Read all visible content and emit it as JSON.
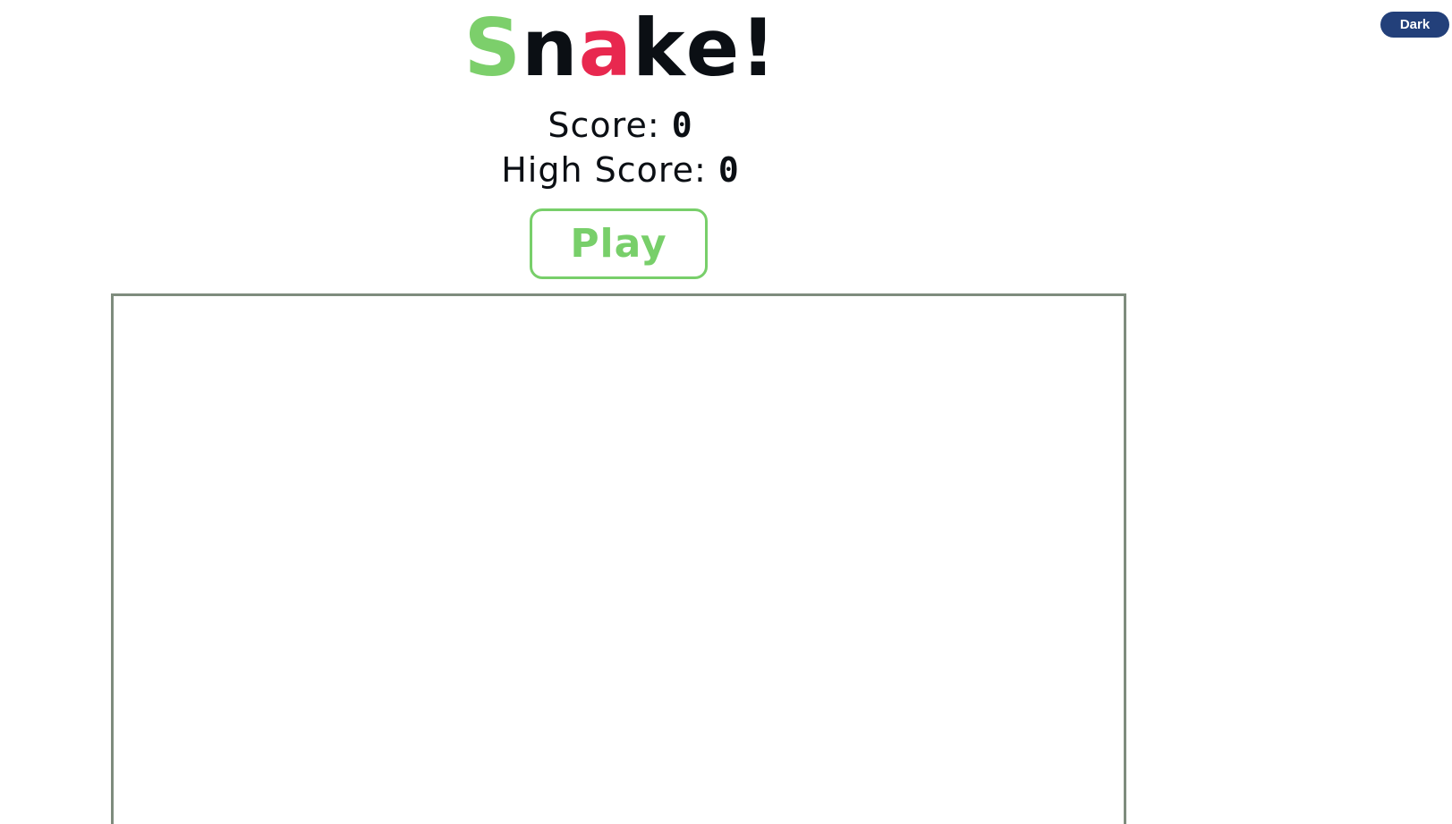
{
  "theme_toggle": {
    "label": "Dark",
    "color": "#23407a"
  },
  "title": {
    "letters": [
      {
        "char": "S",
        "color": "#7ccf6b"
      },
      {
        "char": "n",
        "color": "#0b0f14"
      },
      {
        "char": "a",
        "color": "#e8284f"
      },
      {
        "char": "k",
        "color": "#0b0f14"
      },
      {
        "char": "e",
        "color": "#0b0f14"
      },
      {
        "char": "!",
        "color": "#0b0f14"
      }
    ]
  },
  "score": {
    "label": "Score: ",
    "value": "0"
  },
  "high_score": {
    "label": "High Score: ",
    "value": "0"
  },
  "play_button": {
    "label": "Play",
    "color": "#78cf6a"
  },
  "board": {
    "border_color": "#7e8c7d"
  }
}
